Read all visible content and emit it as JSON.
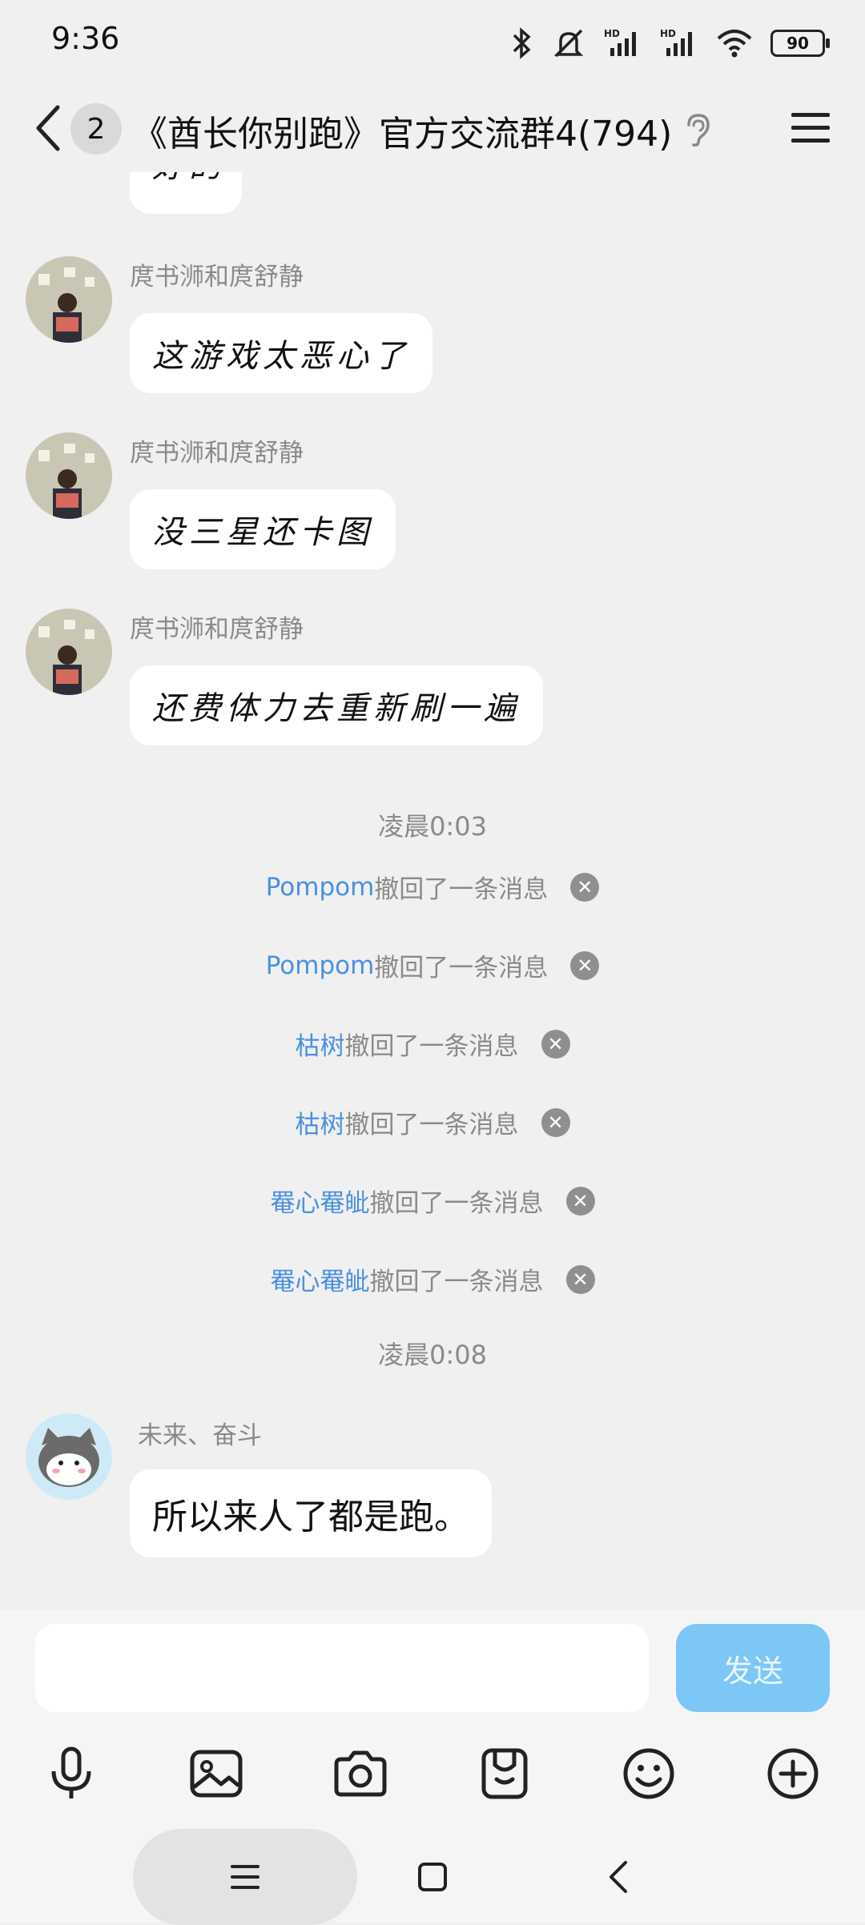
{
  "status_bar": {
    "time": "9:36",
    "battery": "90"
  },
  "header": {
    "unread_count": "2",
    "title": "《酋长你别跑》官方交流群4(794)"
  },
  "messages": [
    {
      "sender": "庹书浉和庹舒静",
      "text": "这游戏太恶心了"
    },
    {
      "sender": "庹书浉和庹舒静",
      "text": "没三星还卡图"
    },
    {
      "sender": "庹书浉和庹舒静",
      "text": "还费体力去重新刷一遍"
    }
  ],
  "partial_bubble_text": "好的",
  "timestamp_1": "凌晨0:03",
  "recalls": [
    {
      "who": "Pompom",
      "text": "撤回了一条消息"
    },
    {
      "who": "Pompom",
      "text": "撤回了一条消息"
    },
    {
      "who": "枯树",
      "text": "撤回了一条消息"
    },
    {
      "who": "枯树",
      "text": "撤回了一条消息"
    },
    {
      "who": "罨心罨皉",
      "text": "撤回了一条消息"
    },
    {
      "who": "罨心罨皉",
      "text": "撤回了一条消息"
    }
  ],
  "timestamp_2": "凌晨0:08",
  "last_message": {
    "sender": "未来、奋斗",
    "text": "所以来人了都是跑。"
  },
  "input": {
    "placeholder": "",
    "value": "",
    "send_label": "发送"
  },
  "colors": {
    "link": "#4a90e2",
    "send_button": "#7cc7f5",
    "background": "#f0f0f0"
  },
  "icons": [
    "back-icon",
    "ear-icon",
    "menu-icon",
    "microphone-icon",
    "image-icon",
    "camera-icon",
    "sticker-icon",
    "emoji-icon",
    "plus-icon",
    "nav-menu-icon",
    "nav-home-icon",
    "nav-back-icon"
  ]
}
